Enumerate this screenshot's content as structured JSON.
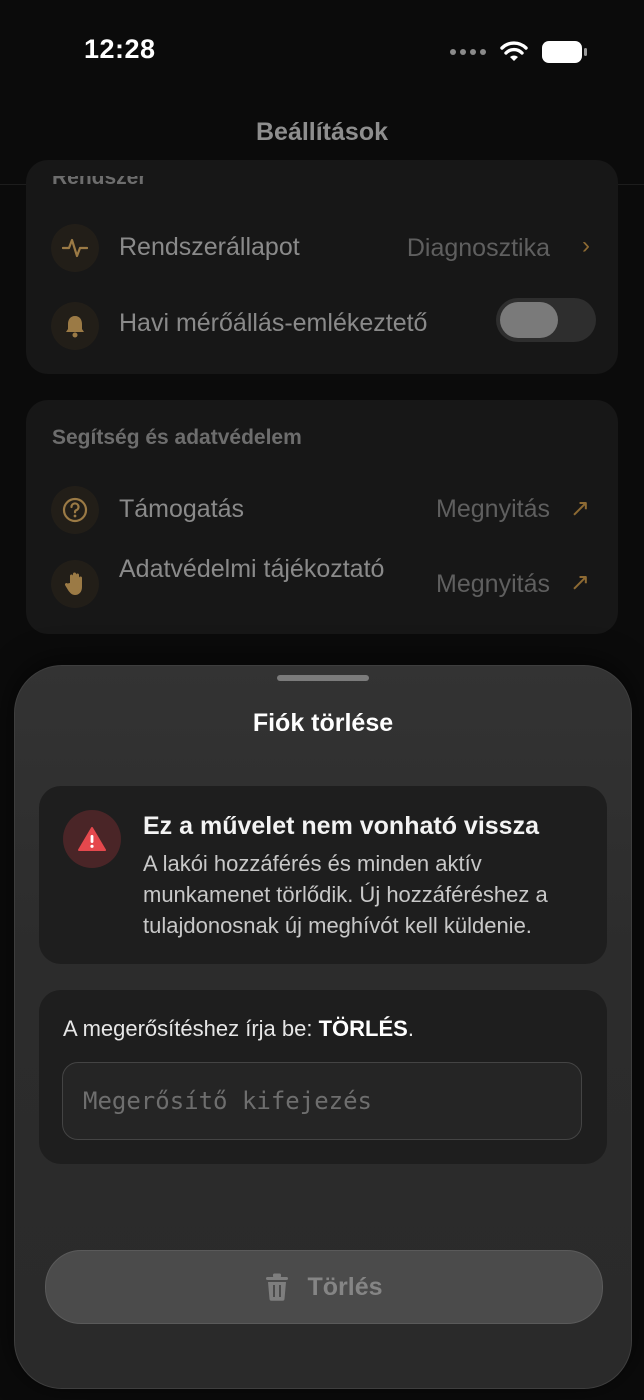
{
  "status_bar": {
    "time": "12:28"
  },
  "nav": {
    "title": "Beállítások"
  },
  "system_section": {
    "header": "Rendszer",
    "rows": [
      {
        "label": "Rendszerállapot",
        "value": "Diagnosztika",
        "icon": "pulse-icon"
      },
      {
        "label": "Havi mérőállás-emlékeztető",
        "toggle_on": false,
        "icon": "bell-icon"
      }
    ]
  },
  "help_section": {
    "header": "Segítség és adatvédelem",
    "rows": [
      {
        "label": "Támogatás",
        "value": "Megnyitás",
        "icon": "question-circle-icon"
      },
      {
        "label": "Adatvédelmi tájékoztató",
        "value": "Megnyitás",
        "icon": "hand-icon"
      }
    ]
  },
  "sheet": {
    "title": "Fiók törlése",
    "warning": {
      "title": "Ez a művelet nem vonható vissza",
      "text": "A lakói hozzáférés és minden aktív munkamenet törlődik. Új hozzáféréshez a tulajdonosnak új meghívót kell küldenie."
    },
    "confirm": {
      "label_prefix": "A megerősítéshez írja be: ",
      "keyword": "TÖRLÉS",
      "label_suffix": ".",
      "placeholder": "Megerősítő kifejezés",
      "value": ""
    },
    "delete_button": "Törlés"
  },
  "colors": {
    "accent": "#C99A4F",
    "danger": "#E5484D",
    "sheet_bg": "#2E2E2E"
  }
}
